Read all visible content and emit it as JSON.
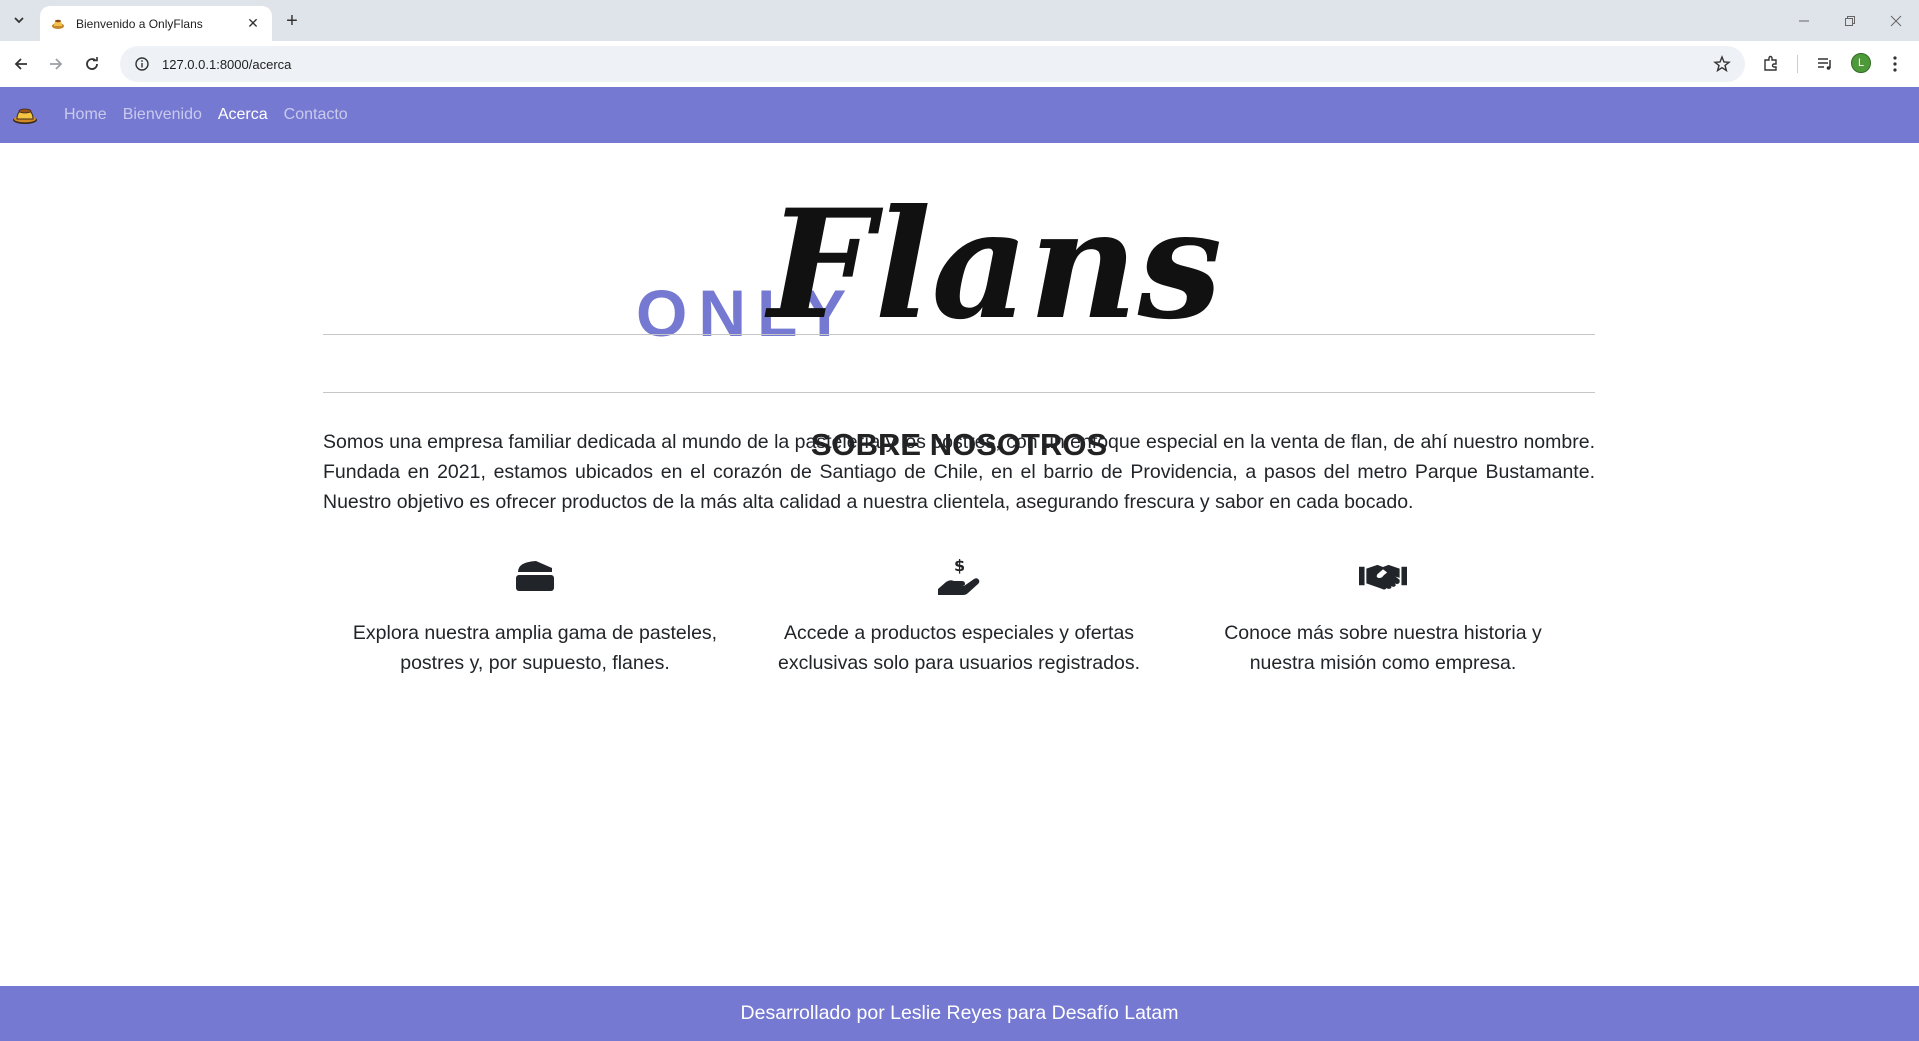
{
  "browser": {
    "tab_title": "Bienvenido a OnlyFlans",
    "url": "127.0.0.1:8000/acerca",
    "profile_initial": "L",
    "icons": [
      "tab-list-icon",
      "favicon-icon",
      "close-icon",
      "plus-icon",
      "back-icon",
      "forward-icon",
      "reload-icon",
      "info-icon",
      "star-icon",
      "extensions-icon",
      "media-icon",
      "menu-icon",
      "minimize-icon",
      "restore-icon",
      "window-close-icon"
    ]
  },
  "navbar": {
    "links": [
      {
        "label": "Home",
        "active": false
      },
      {
        "label": "Bienvenido",
        "active": false
      },
      {
        "label": "Acerca",
        "active": true
      },
      {
        "label": "Contacto",
        "active": false
      }
    ],
    "color": "#7679d1"
  },
  "logo": {
    "only": "ONLY",
    "flans": "Flans"
  },
  "about": {
    "title": "SOBRE NOSOTROS",
    "text": "Somos una empresa familiar dedicada al mundo de la pastelería y los postres, con un enfoque especial en la venta de flan, de ahí nuestro nombre. Fundada en 2021, estamos ubicados en el corazón de Santiago de Chile, en el barrio de Providencia, a pasos del metro Parque Bustamante. Nuestro objetivo es ofrecer productos de la más alta calidad a nuestra clientela, asegurando frescura y sabor en cada bocado."
  },
  "features": [
    {
      "icon": "cake-slice-icon",
      "text": "Explora nuestra amplia gama de pasteles, postres y, por supuesto, flanes."
    },
    {
      "icon": "hand-dollar-icon",
      "text": "Accede a productos especiales y ofertas exclusivas solo para usuarios registrados."
    },
    {
      "icon": "handshake-icon",
      "text": "Conoce más sobre nuestra historia y nuestra misión como empresa."
    }
  ],
  "footer": {
    "text": "Desarrollado por Leslie Reyes para Desafío Latam"
  }
}
